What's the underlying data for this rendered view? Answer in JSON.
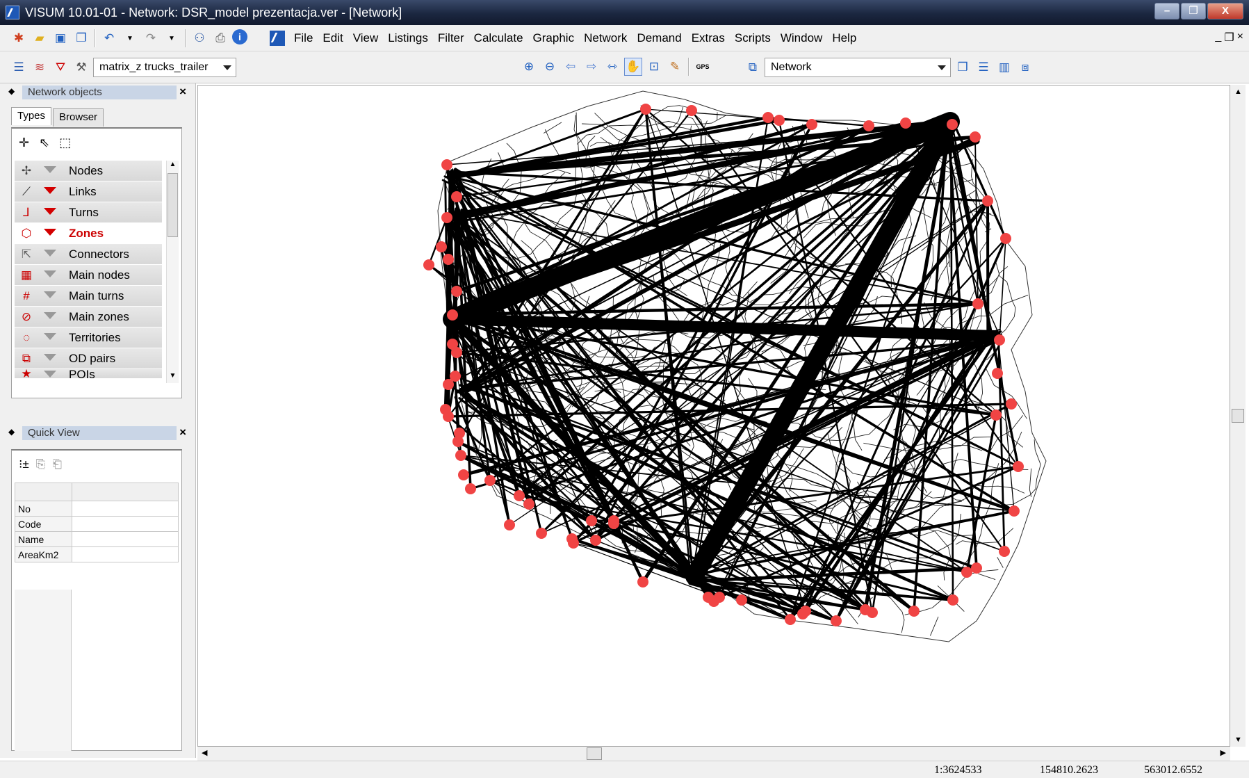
{
  "window": {
    "title": "VISUM 10.01-01 - Network: DSR_model prezentacja.ver - [Network]",
    "controls": {
      "minimize": "–",
      "restore": "❐",
      "close": "X"
    }
  },
  "menu": [
    "File",
    "Edit",
    "View",
    "Listings",
    "Filter",
    "Calculate",
    "Graphic",
    "Network",
    "Demand",
    "Extras",
    "Scripts",
    "Window",
    "Help"
  ],
  "mdi_controls": {
    "minimize": "_",
    "restore": "❐",
    "close": "×"
  },
  "toolbar": {
    "matrix_select": "matrix_z trucks_trailer",
    "view_select": "Network"
  },
  "network_objects_panel": {
    "title": "Network objects",
    "tabs": [
      "Types",
      "Browser"
    ],
    "active_tab": "Types",
    "items": [
      {
        "label": "Nodes",
        "icon": "node-icon",
        "filter_active": false
      },
      {
        "label": "Links",
        "icon": "link-icon",
        "filter_active": true
      },
      {
        "label": "Turns",
        "icon": "turn-icon",
        "filter_active": true
      },
      {
        "label": "Zones",
        "icon": "zone-icon",
        "filter_active": true,
        "selected": true
      },
      {
        "label": "Connectors",
        "icon": "connector-icon",
        "filter_active": false
      },
      {
        "label": "Main nodes",
        "icon": "main-node-icon",
        "filter_active": false
      },
      {
        "label": "Main turns",
        "icon": "main-turn-icon",
        "filter_active": false
      },
      {
        "label": "Main zones",
        "icon": "main-zone-icon",
        "filter_active": false
      },
      {
        "label": "Territories",
        "icon": "territory-icon",
        "filter_active": false
      },
      {
        "label": "OD pairs",
        "icon": "od-pair-icon",
        "filter_active": false
      },
      {
        "label": "POIs",
        "icon": "poi-icon",
        "filter_active": false
      }
    ]
  },
  "quick_view_panel": {
    "title": "Quick View",
    "rows": [
      "No",
      "Code",
      "Name",
      "AreaKm2"
    ]
  },
  "status": {
    "scale": "1:3624533",
    "x": "154810.2623",
    "y": "563012.6552"
  },
  "colors": {
    "zone_marker": "#f04444",
    "flow_bar": "#000000",
    "network_link": "#222222",
    "panel_header": "#c9d5e6"
  }
}
